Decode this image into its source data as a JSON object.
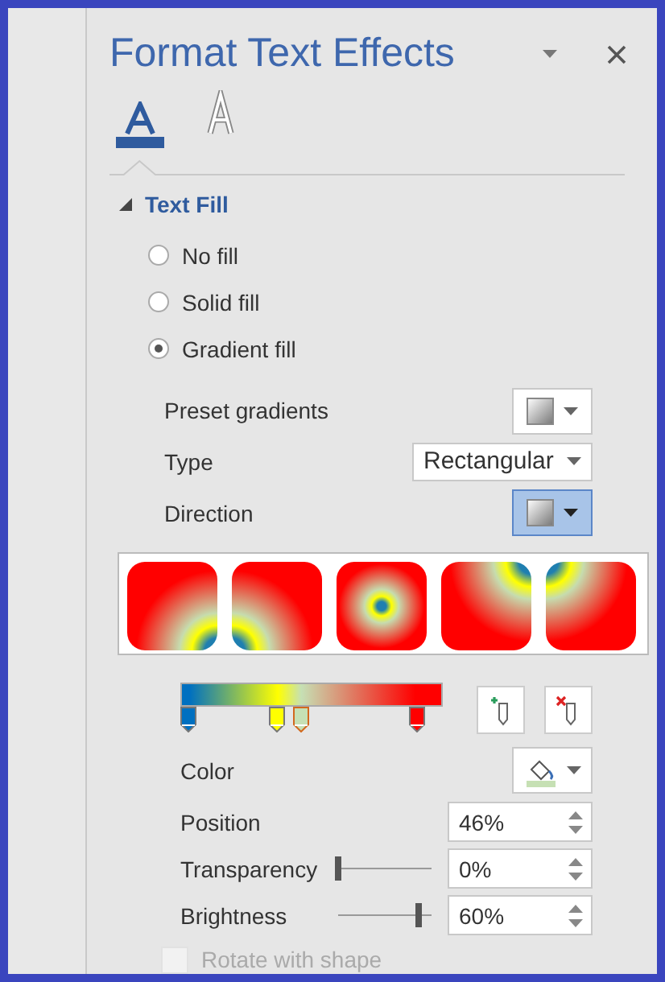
{
  "panel": {
    "title": "Format Text Effects"
  },
  "tabs": [
    {
      "kind": "fill",
      "selected": true
    },
    {
      "kind": "outline",
      "selected": false
    }
  ],
  "section": {
    "title": "Text Fill",
    "expanded": true
  },
  "fill_options": [
    {
      "label": "No fill",
      "selected": false
    },
    {
      "label": "Solid fill",
      "selected": false
    },
    {
      "label": "Gradient fill",
      "selected": true
    }
  ],
  "preset_gradients": {
    "label": "Preset gradients"
  },
  "type": {
    "label": "Type",
    "value": "Rectangular"
  },
  "direction": {
    "label": "Direction",
    "open": true
  },
  "direction_options": [
    {
      "kind": "bottom-right"
    },
    {
      "kind": "bottom-left"
    },
    {
      "kind": "center"
    },
    {
      "kind": "top-right"
    },
    {
      "kind": "top-left"
    }
  ],
  "gradient_stops": [
    {
      "color": "#0070c0",
      "level": 0.03,
      "selected": false
    },
    {
      "color": "#ffff00",
      "level": 0.37,
      "selected": false
    },
    {
      "color": "#c6e0b4",
      "level": 0.46,
      "selected": true
    },
    {
      "color": "#ff0000",
      "level": 0.9,
      "selected": false
    }
  ],
  "color": {
    "label": "Color"
  },
  "position": {
    "label": "Position",
    "value": "46%"
  },
  "transparency": {
    "label": "Transparency",
    "value": "0%",
    "level": 0
  },
  "brightness": {
    "label": "Brightness",
    "value": "60%",
    "level": 0.8
  },
  "rotate_with_shape": {
    "label": "Rotate with shape",
    "checked": false,
    "disabled": true
  }
}
